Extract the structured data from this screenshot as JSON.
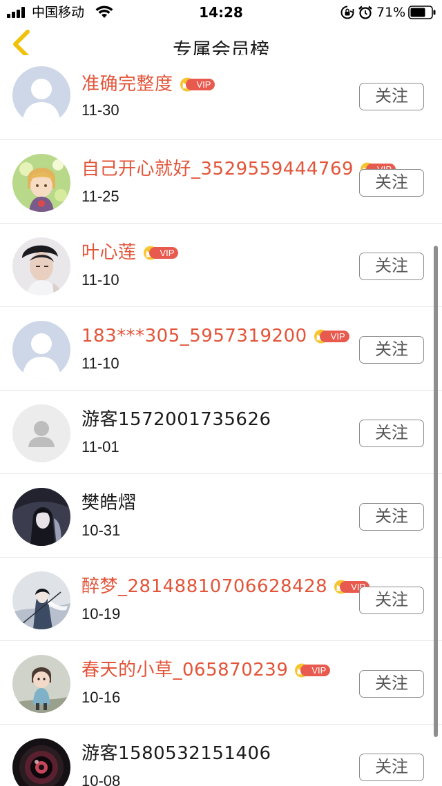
{
  "status_bar": {
    "carrier": "中国移动",
    "time": "14:28",
    "battery_percent": "71%",
    "icons": [
      "signal-icon",
      "wifi-icon",
      "orientation-lock-icon",
      "alarm-icon",
      "battery-icon"
    ]
  },
  "nav": {
    "title": "专属会员榜",
    "back_icon": "chevron-left-icon"
  },
  "colors": {
    "vip_name": "#e2553a",
    "vip_badge": "#e8594e",
    "back_arrow": "#f0c20a"
  },
  "members": [
    {
      "name": "准确完整度",
      "date": "11-30",
      "vip": true,
      "avatar": "default-silhouette",
      "follow_label": "关注"
    },
    {
      "name": "自己开心就好_3529559444769",
      "date": "11-25",
      "vip": true,
      "avatar": "anime-boy",
      "follow_label": "关注"
    },
    {
      "name": "叶心莲",
      "date": "11-10",
      "vip": true,
      "avatar": "photo-young-man",
      "follow_label": "关注"
    },
    {
      "name": "183***305_5957319200",
      "date": "11-10",
      "vip": true,
      "avatar": "default-silhouette",
      "follow_label": "关注"
    },
    {
      "name": "游客1572001735626",
      "date": "11-01",
      "vip": false,
      "avatar": "guest-placeholder",
      "follow_label": "关注"
    },
    {
      "name": "樊皓熠",
      "date": "10-31",
      "vip": false,
      "avatar": "dark-anime",
      "follow_label": "关注"
    },
    {
      "name": "醉梦_28148810706628428",
      "date": "10-19",
      "vip": true,
      "avatar": "ink-swordsman",
      "follow_label": "关注"
    },
    {
      "name": "春天的小草_065870239",
      "date": "10-16",
      "vip": true,
      "avatar": "photo-toddler",
      "follow_label": "关注"
    },
    {
      "name": "游客1580532151406",
      "date": "10-08",
      "vip": false,
      "avatar": "camera-lens",
      "follow_label": "关注"
    }
  ],
  "vip_badge_label": "VIP"
}
